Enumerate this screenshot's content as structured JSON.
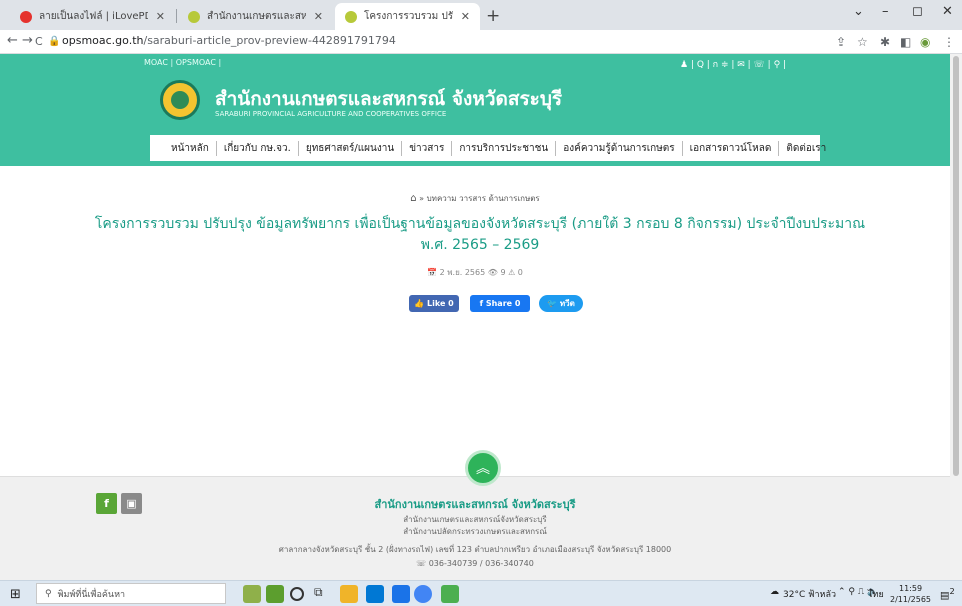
{
  "browser": {
    "tabs": [
      {
        "title": "ลายเป็นลงไฟล์ | iLovePDF",
        "active": false,
        "favicon_color": "#e5322d"
      },
      {
        "title": "สำนักงานเกษตรและสหกรณ์ จังหวัดสระ",
        "active": false,
        "favicon_color": "#b7c93a"
      },
      {
        "title": "โครงการรวบรวม ปรับปรุง ข้อมูลทรัพยา",
        "active": true,
        "favicon_color": "#b7c93a"
      }
    ],
    "url_host": "opsmoac.go.th",
    "url_path": "/saraburi-article_prov-preview-442891791794"
  },
  "site": {
    "top_links": "MOAC  |  OPSMOAC  |",
    "top_icons": "♟ | Q | ก ≑ | ✉ | ☏ | ⚲ |",
    "org_name": "สำนักงานเกษตรและสหกรณ์ จังหวัดสระบุรี",
    "org_subtitle": "SARABURI PROVINCIAL AGRICULTURE AND COOPERATIVES OFFICE",
    "menu": [
      "หน้าหลัก",
      "เกี่ยวกับ กษ.จว.",
      "ยุทธศาสตร์/แผนงาน",
      "ข่าวสาร",
      "การบริการประชาชน",
      "องค์ความรู้ด้านการเกษตร",
      "เอกสารดาวน์โหลด",
      "ติดต่อเรา"
    ],
    "breadcrumb": "»  บทความ วารสาร ด้านการเกษตร",
    "headline": "โครงการรวบรวม ปรับปรุง ข้อมูลทรัพยากร เพื่อเป็นฐานข้อมูลของจังหวัดสระบุรี (ภายใต้ 3 กรอบ 8 กิจกรรม) ประจำปีงบประมาณ พ.ศ. 2565 – 2569",
    "meta": "📅 2 พ.ย. 2565   👁 9   ⚠ 0",
    "social": {
      "like": "👍 Like 0",
      "share": "f  Share 0",
      "tweet": "🐦 ทวีต"
    },
    "footer": {
      "title": "สำนักงานเกษตรและสหกรณ์ จังหวัดสระบุรี",
      "line1": "สำนักงานเกษตรและสหกรณ์จังหวัดสระบุรี",
      "line2": "สำนักงานปลัดกระทรวงเกษตรและสหกรณ์",
      "address": "ศาลากลางจังหวัดสระบุรี ชั้น 2 (ฝั่งทางรถไฟ) เลขที่ 123 ตำบลปากเพรียว อำเภอเมืองสระบุรี จังหวัดสระบุรี 18000",
      "phone": "☏ 036-340739 / 036-340740"
    }
  },
  "taskbar": {
    "search_placeholder": "พิมพ์ที่นี่เพื่อค้นหา",
    "weather": "32°C ฟ้าหลัว",
    "lang": "ไทย",
    "time": "11:59",
    "date": "2/11/2565",
    "notif_count": "2"
  }
}
